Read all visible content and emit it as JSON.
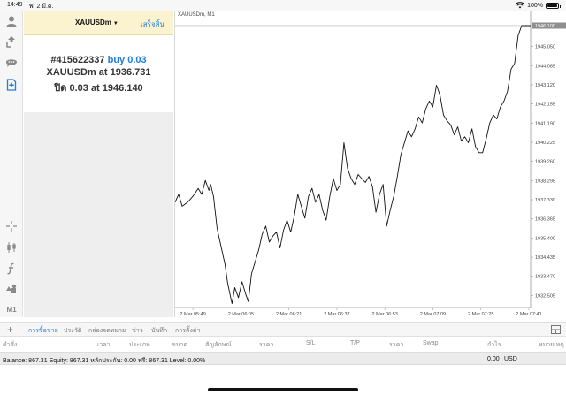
{
  "status": {
    "time": "14:49",
    "date": "พ. 2 มี.ค.",
    "battery": "100%",
    "battery_level": 1.0
  },
  "toolbar": {
    "timeframe": "M1"
  },
  "trade": {
    "symbol": "XAUUSDm",
    "done_label": "เสร็จสิ้น",
    "order_id": "#415622337",
    "order_side": "buy 0.03",
    "open_prefix": "XAUUSDm at",
    "open_price": "1936.731",
    "close_prefix": "ปิด 0.03 at",
    "close_price": "1946.140"
  },
  "chart_data": {
    "type": "line",
    "title": "XAUUSDm, M1",
    "current_price": "1946.100",
    "y_ticks": [
      "1946.030",
      "1945.050",
      "1944.085",
      "1943.120",
      "1942.155",
      "1941.190",
      "1940.225",
      "1939.260",
      "1938.295",
      "1937.330",
      "1936.365",
      "1935.400",
      "1934.435",
      "1933.470",
      "1932.505"
    ],
    "ylim": [
      1931.9,
      1946.5
    ],
    "x_ticks": [
      "2 Mar 05:49",
      "2 Mar 06:05",
      "2 Mar 06:21",
      "2 Mar 06:37",
      "2 Mar 06:53",
      "2 Mar 07:09",
      "2 Mar 07:25",
      "2 Mar 07:41"
    ],
    "x_tick_pos": [
      0.05,
      0.185,
      0.32,
      0.455,
      0.59,
      0.725,
      0.86,
      0.995
    ],
    "x": [
      0,
      0.01,
      0.02,
      0.035,
      0.05,
      0.065,
      0.075,
      0.085,
      0.095,
      0.1,
      0.108,
      0.118,
      0.13,
      0.14,
      0.148,
      0.16,
      0.168,
      0.178,
      0.188,
      0.198,
      0.206,
      0.215,
      0.225,
      0.235,
      0.245,
      0.255,
      0.265,
      0.275,
      0.285,
      0.295,
      0.305,
      0.315,
      0.325,
      0.335,
      0.345,
      0.355,
      0.365,
      0.375,
      0.385,
      0.395,
      0.405,
      0.415,
      0.425,
      0.435,
      0.445,
      0.455,
      0.465,
      0.475,
      0.485,
      0.495,
      0.505,
      0.515,
      0.525,
      0.535,
      0.545,
      0.555,
      0.565,
      0.575,
      0.585,
      0.595,
      0.605,
      0.615,
      0.625,
      0.635,
      0.645,
      0.655,
      0.665,
      0.675,
      0.685,
      0.695,
      0.705,
      0.715,
      0.725,
      0.735,
      0.745,
      0.755,
      0.765,
      0.775,
      0.785,
      0.795,
      0.805,
      0.815,
      0.825,
      0.835,
      0.845,
      0.855,
      0.865,
      0.875,
      0.885,
      0.895,
      0.905,
      0.915,
      0.925,
      0.935,
      0.945,
      0.955,
      0.965,
      0.975,
      0.985,
      0.995,
      1.0
    ],
    "values": [
      1937.2,
      1937.6,
      1937.0,
      1937.2,
      1937.5,
      1937.9,
      1937.6,
      1938.3,
      1937.8,
      1938.1,
      1937.5,
      1935.9,
      1934.9,
      1934.1,
      1933.1,
      1932.1,
      1932.9,
      1932.4,
      1933.2,
      1932.6,
      1932.2,
      1933.6,
      1934.2,
      1934.8,
      1935.6,
      1936.0,
      1935.2,
      1935.5,
      1935.7,
      1934.9,
      1935.8,
      1936.3,
      1935.7,
      1936.5,
      1937.6,
      1937.0,
      1936.4,
      1937.5,
      1937.9,
      1937.2,
      1937.6,
      1936.8,
      1936.3,
      1937.5,
      1938.4,
      1937.8,
      1938.1,
      1940.2,
      1938.9,
      1938.4,
      1938.1,
      1938.6,
      1938.4,
      1938.2,
      1938.5,
      1938.0,
      1936.7,
      1937.6,
      1938.1,
      1936.0,
      1936.8,
      1937.5,
      1938.5,
      1939.6,
      1940.2,
      1940.8,
      1940.5,
      1940.9,
      1941.5,
      1941.2,
      1941.9,
      1942.3,
      1942.0,
      1943.1,
      1942.6,
      1941.6,
      1941.3,
      1941.1,
      1940.6,
      1941.0,
      1940.3,
      1940.5,
      1940.2,
      1940.9,
      1940.0,
      1939.7,
      1939.7,
      1940.4,
      1941.2,
      1941.6,
      1941.4,
      1942.0,
      1942.3,
      1942.8,
      1943.9,
      1944.2,
      1945.6,
      1946.1,
      1946.1,
      1946.1,
      1946.1
    ]
  },
  "terminal": {
    "tabs": [
      "การซื้อขาย",
      "ประวัติ",
      "กล่องจดหมาย",
      "ข่าว",
      "บันทึก",
      "การตั้งค่า"
    ],
    "columns": [
      "คำสั่ง",
      "เวลา",
      "ประเภท",
      "ขนาด",
      "สัญลักษณ์",
      "ราคา",
      "S/L",
      "T/P",
      "ราคา",
      "Swap",
      "กำไร",
      "หมายเหตุ"
    ],
    "balance_line": "Balance: 867.31 Equity: 867.31 หลักประกัน: 0.00 ฟรี: 867.31 Level: 0.00%",
    "profit": "0.00",
    "currency": "USD"
  },
  "colors": {
    "accent": "#1f7ed8",
    "trade_header": "#fbf3cf",
    "line": "#111111"
  }
}
